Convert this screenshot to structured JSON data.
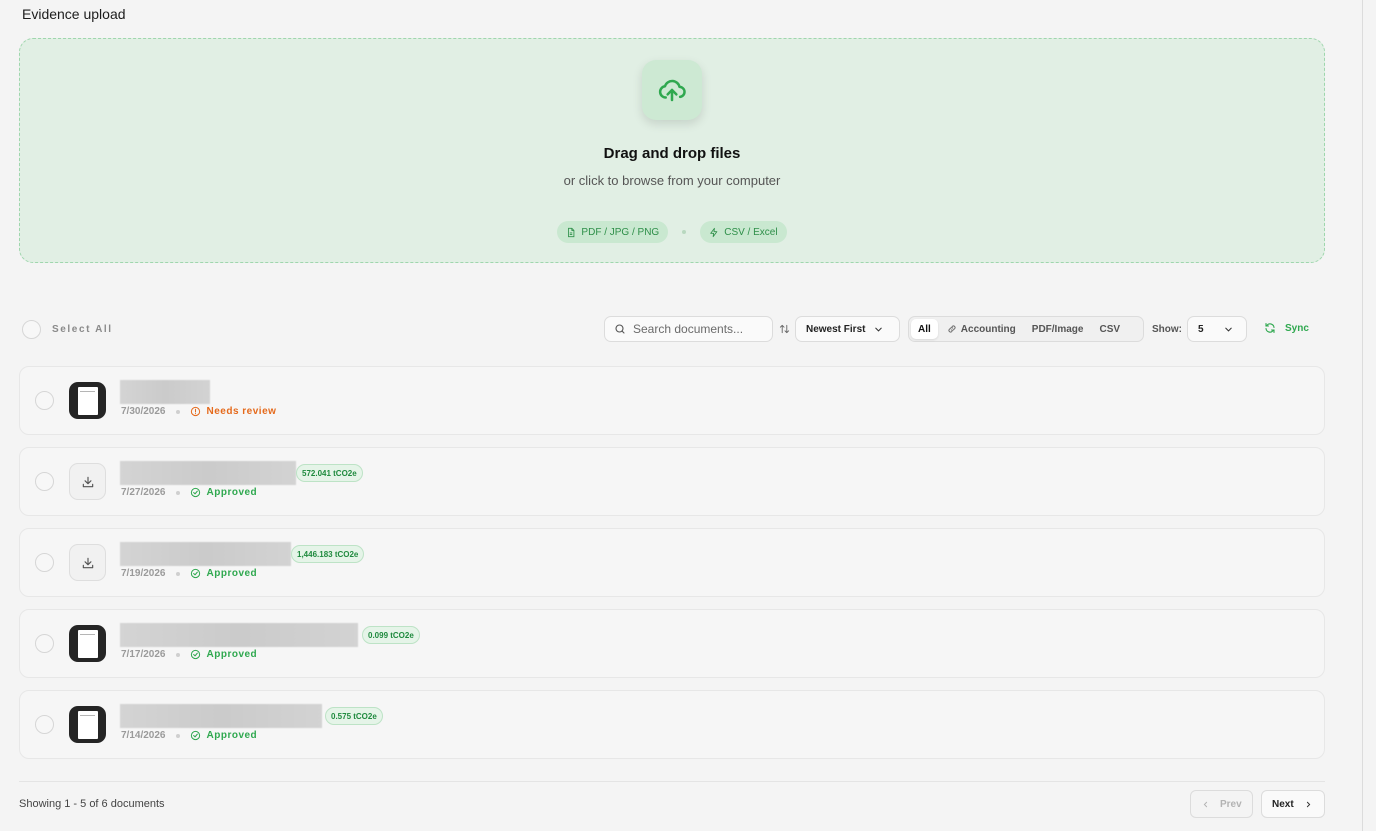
{
  "page": {
    "title": "Evidence upload"
  },
  "upload": {
    "title": "Drag and drop files",
    "subtitle": "or click to browse from your computer",
    "chips": [
      {
        "label": "PDF / JPG / PNG",
        "icon": "file-icon"
      },
      {
        "label": "CSV / Excel",
        "icon": "lightning-icon"
      }
    ],
    "icon": "cloud-upload-icon"
  },
  "toolbar": {
    "select_all": "Select All",
    "search_placeholder": "Search documents...",
    "sort": "Newest First",
    "filters": [
      "All",
      "Accounting",
      "PDF/Image",
      "CSV"
    ],
    "show_label": "Show:",
    "show_value": "5",
    "sync": "Sync"
  },
  "documents": [
    {
      "date": "7/30/2026",
      "status": "Needs review",
      "emission": ""
    },
    {
      "date": "7/27/2026",
      "status": "Approved",
      "emission": "572.041 tCO2e"
    },
    {
      "date": "7/19/2026",
      "status": "Approved",
      "emission": "1,446.183 tCO2e"
    },
    {
      "date": "7/17/2026",
      "status": "Approved",
      "emission": "0.099 tCO2e"
    },
    {
      "date": "7/14/2026",
      "status": "Approved",
      "emission": "0.575 tCO2e"
    }
  ],
  "pagination": {
    "summary": "Showing 1 - 5 of 6 documents",
    "prev": "Prev",
    "next": "Next"
  },
  "colors": {
    "accent_green": "#2fa84f",
    "warning_orange": "#e56a1c",
    "dropzone_bg": "#e1efe4"
  }
}
